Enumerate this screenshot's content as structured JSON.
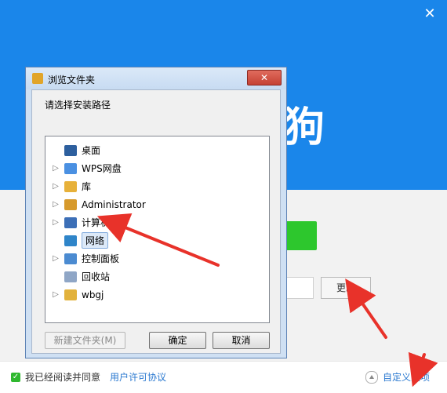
{
  "installer": {
    "close_glyph": "✕",
    "brand_text": "狗",
    "change_button": "更改",
    "agree_text": "我已经阅读并同意",
    "license_link": "用户许可协议",
    "custom_options": "自定义选项"
  },
  "dialog": {
    "title": "浏览文件夹",
    "close_glyph": "✕",
    "prompt": "请选择安装路径",
    "items": [
      {
        "label": "桌面",
        "icon": "desktop-icon",
        "expandable": false,
        "indent": 0
      },
      {
        "label": "WPS网盘",
        "icon": "cloud-icon",
        "expandable": true,
        "indent": 1
      },
      {
        "label": "库",
        "icon": "library-icon",
        "expandable": true,
        "indent": 1
      },
      {
        "label": "Administrator",
        "icon": "user-folder-icon",
        "expandable": true,
        "indent": 1
      },
      {
        "label": "计算机",
        "icon": "computer-icon",
        "expandable": true,
        "indent": 1
      },
      {
        "label": "网络",
        "icon": "network-icon",
        "expandable": false,
        "indent": 1,
        "selected": true
      },
      {
        "label": "控制面板",
        "icon": "control-panel-icon",
        "expandable": true,
        "indent": 1
      },
      {
        "label": "回收站",
        "icon": "recycle-bin-icon",
        "expandable": false,
        "indent": 1
      },
      {
        "label": "wbgj",
        "icon": "folder-icon",
        "expandable": true,
        "indent": 1
      }
    ],
    "new_folder_button": "新建文件夹(M)",
    "ok_button": "确定",
    "cancel_button": "取消"
  },
  "colors": {
    "installer_blue": "#1a86ea",
    "green": "#2dc72d",
    "annotation_red": "#e8322a"
  }
}
